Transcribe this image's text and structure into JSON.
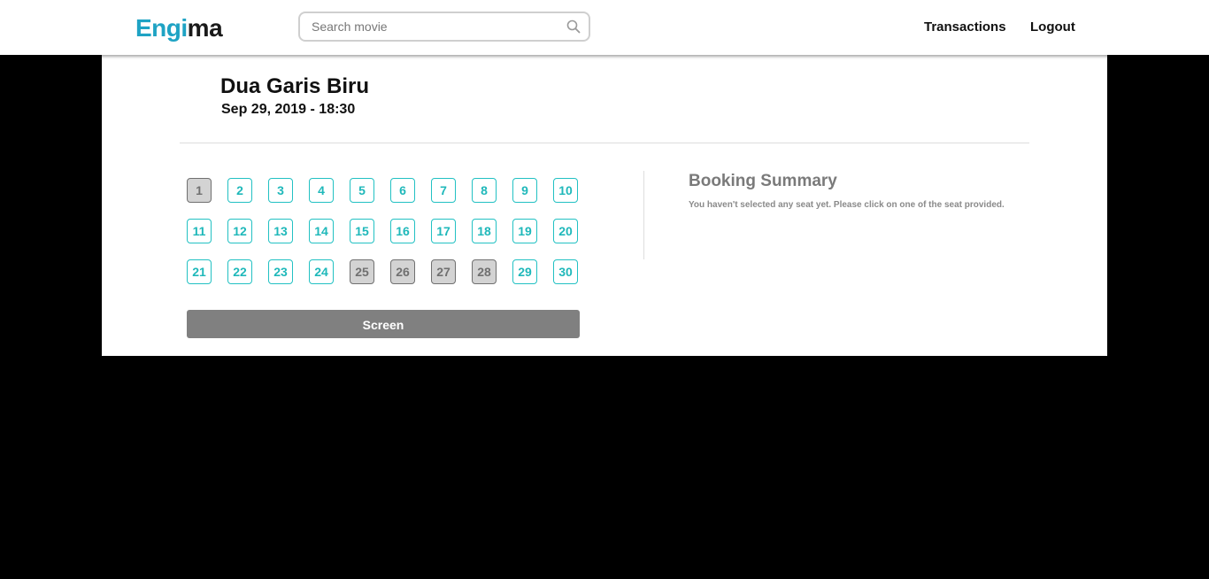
{
  "brand": {
    "logo_part1": "Engi",
    "logo_part2": "ma",
    "accent_color": "#1fa3c4"
  },
  "search": {
    "placeholder": "Search movie",
    "value": "",
    "icon": "search-icon"
  },
  "nav": {
    "transactions_label": "Transactions",
    "logout_label": "Logout"
  },
  "movie": {
    "title": "Dua Garis Biru",
    "datetime": "Sep 29, 2019 - 18:30"
  },
  "seats": [
    {
      "number": "1",
      "taken": true
    },
    {
      "number": "2",
      "taken": false
    },
    {
      "number": "3",
      "taken": false
    },
    {
      "number": "4",
      "taken": false
    },
    {
      "number": "5",
      "taken": false
    },
    {
      "number": "6",
      "taken": false
    },
    {
      "number": "7",
      "taken": false
    },
    {
      "number": "8",
      "taken": false
    },
    {
      "number": "9",
      "taken": false
    },
    {
      "number": "10",
      "taken": false
    },
    {
      "number": "11",
      "taken": false
    },
    {
      "number": "12",
      "taken": false
    },
    {
      "number": "13",
      "taken": false
    },
    {
      "number": "14",
      "taken": false
    },
    {
      "number": "15",
      "taken": false
    },
    {
      "number": "16",
      "taken": false
    },
    {
      "number": "17",
      "taken": false
    },
    {
      "number": "18",
      "taken": false
    },
    {
      "number": "19",
      "taken": false
    },
    {
      "number": "20",
      "taken": false
    },
    {
      "number": "21",
      "taken": false
    },
    {
      "number": "22",
      "taken": false
    },
    {
      "number": "23",
      "taken": false
    },
    {
      "number": "24",
      "taken": false
    },
    {
      "number": "25",
      "taken": true
    },
    {
      "number": "26",
      "taken": true
    },
    {
      "number": "27",
      "taken": true
    },
    {
      "number": "28",
      "taken": true
    },
    {
      "number": "29",
      "taken": false
    },
    {
      "number": "30",
      "taken": false
    }
  ],
  "screen_label": "Screen",
  "summary": {
    "title": "Booking Summary",
    "message": "You haven't selected any seat yet. Please click on one of the seat provided."
  },
  "colors": {
    "seat_available": "#22c1c3",
    "seat_taken": "#d3d3d3",
    "screen": "#808080"
  }
}
